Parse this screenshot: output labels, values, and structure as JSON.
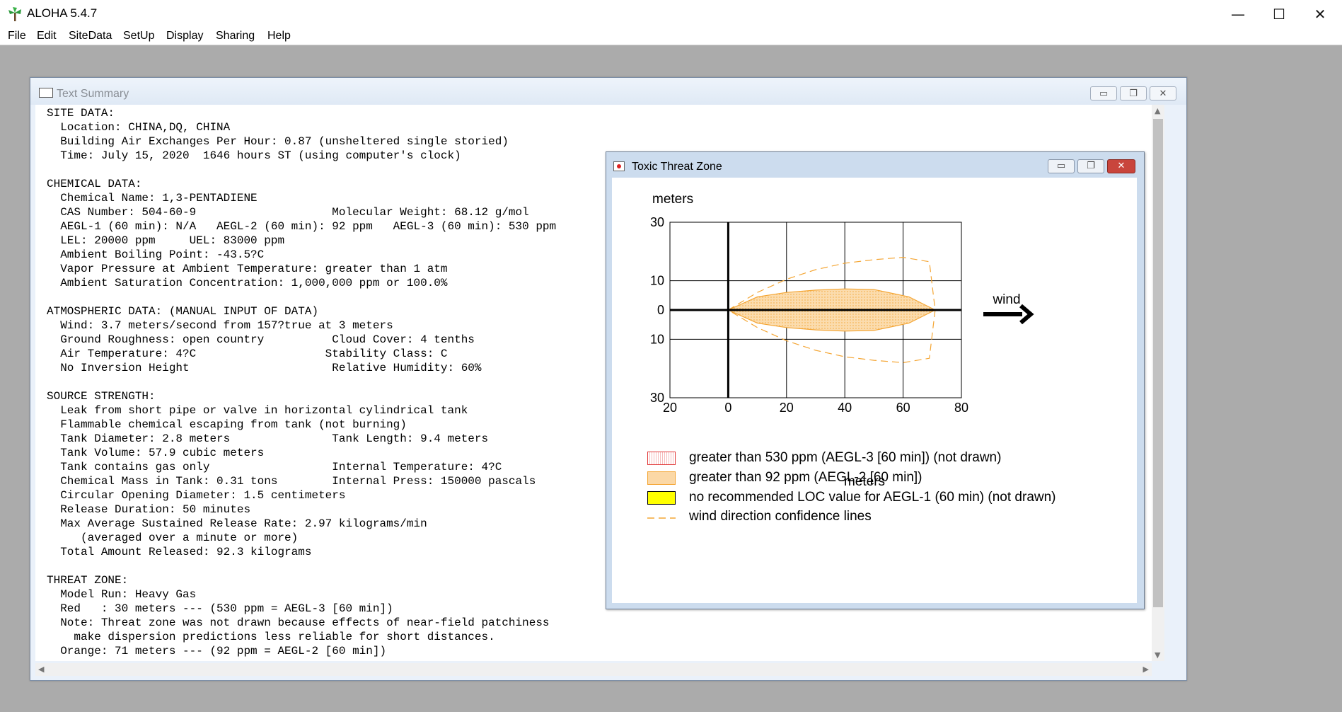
{
  "app": {
    "title": "ALOHA 5.4.7",
    "window_controls": {
      "minimize": "—",
      "maximize": "☐",
      "close": "✕"
    }
  },
  "menu": [
    "File",
    "Edit",
    "SiteData",
    "SetUp",
    "Display",
    "Sharing",
    "Help"
  ],
  "summary_window": {
    "title": "Text Summary",
    "text_lines": [
      "SITE DATA:",
      "  Location: CHINA,DQ, CHINA",
      "  Building Air Exchanges Per Hour: 0.87 (unsheltered single storied)",
      "  Time: July 15, 2020  1646 hours ST (using computer's clock)",
      "",
      "CHEMICAL DATA:",
      "  Chemical Name: 1,3-PENTADIENE",
      "  CAS Number: 504-60-9                    Molecular Weight: 68.12 g/mol",
      "  AEGL-1 (60 min): N/A   AEGL-2 (60 min): 92 ppm   AEGL-3 (60 min): 530 ppm",
      "  LEL: 20000 ppm     UEL: 83000 ppm",
      "  Ambient Boiling Point: -43.5?C",
      "  Vapor Pressure at Ambient Temperature: greater than 1 atm",
      "  Ambient Saturation Concentration: 1,000,000 ppm or 100.0%",
      "",
      "ATMOSPHERIC DATA: (MANUAL INPUT OF DATA)",
      "  Wind: 3.7 meters/second from 157?true at 3 meters",
      "  Ground Roughness: open country          Cloud Cover: 4 tenths",
      "  Air Temperature: 4?C                   Stability Class: C",
      "  No Inversion Height                     Relative Humidity: 60%",
      "",
      "SOURCE STRENGTH:",
      "  Leak from short pipe or valve in horizontal cylindrical tank",
      "  Flammable chemical escaping from tank (not burning)",
      "  Tank Diameter: 2.8 meters               Tank Length: 9.4 meters",
      "  Tank Volume: 57.9 cubic meters",
      "  Tank contains gas only                  Internal Temperature: 4?C",
      "  Chemical Mass in Tank: 0.31 tons        Internal Press: 150000 pascals",
      "  Circular Opening Diameter: 1.5 centimeters",
      "  Release Duration: 50 minutes",
      "  Max Average Sustained Release Rate: 2.97 kilograms/min",
      "     (averaged over a minute or more)",
      "  Total Amount Released: 92.3 kilograms",
      "",
      "THREAT ZONE:",
      "  Model Run: Heavy Gas",
      "  Red   : 30 meters --- (530 ppm = AEGL-3 [60 min])",
      "  Note: Threat zone was not drawn because effects of near-field patchiness",
      "    make dispersion predictions less reliable for short distances.",
      "  Orange: 71 meters --- (92 ppm = AEGL-2 [60 min])"
    ]
  },
  "threat_window": {
    "title": "Toxic Threat Zone",
    "chart_data": {
      "type": "area",
      "ylabel": "meters",
      "xlabel": "meters",
      "xlim": [
        -20,
        80
      ],
      "ylim": [
        -30,
        30
      ],
      "x_tick_labels": [
        {
          "value": -20,
          "label": "20"
        },
        {
          "value": 0,
          "label": "0"
        },
        {
          "value": 20,
          "label": "20"
        },
        {
          "value": 40,
          "label": "40"
        },
        {
          "value": 60,
          "label": "60"
        },
        {
          "value": 80,
          "label": "80"
        }
      ],
      "y_tick_labels": [
        {
          "value": 30,
          "label": "30"
        },
        {
          "value": 10,
          "label": "10"
        },
        {
          "value": 0,
          "label": "0"
        },
        {
          "value": -10,
          "label": "10"
        },
        {
          "value": -30,
          "label": "30"
        }
      ],
      "grid": true,
      "series": [
        {
          "name": "greater than 92 ppm (AEGL-2 [60 min])",
          "style": "filled",
          "color": "#f4a533",
          "fill": "#fbdcae",
          "points": [
            [
              0,
              0
            ],
            [
              10,
              4.5
            ],
            [
              20,
              6
            ],
            [
              30,
              6.8
            ],
            [
              40,
              7.2
            ],
            [
              50,
              7
            ],
            [
              62,
              4.5
            ],
            [
              71,
              0
            ],
            [
              62,
              -4.5
            ],
            [
              50,
              -7
            ],
            [
              40,
              -7.2
            ],
            [
              30,
              -6.8
            ],
            [
              20,
              -6
            ],
            [
              10,
              -4.5
            ],
            [
              0,
              0
            ]
          ]
        },
        {
          "name": "wind direction confidence lines",
          "style": "dashed",
          "color": "#f4a533",
          "points": [
            [
              0,
              0
            ],
            [
              10,
              6
            ],
            [
              20,
              10.5
            ],
            [
              30,
              13.8
            ],
            [
              40,
              16
            ],
            [
              50,
              17.2
            ],
            [
              60,
              18
            ],
            [
              69,
              16.5
            ],
            [
              71,
              0
            ],
            [
              69,
              -16.5
            ],
            [
              60,
              -18
            ],
            [
              50,
              -17.2
            ],
            [
              40,
              -16
            ],
            [
              30,
              -13.8
            ],
            [
              20,
              -10.5
            ],
            [
              10,
              -6
            ],
            [
              0,
              0
            ]
          ]
        }
      ],
      "wind_label": "wind"
    },
    "legend": [
      {
        "text": "greater than 530 ppm (AEGL-3 [60 min]) (not drawn)",
        "swatch": "red-dotted"
      },
      {
        "text": "greater than 92 ppm (AEGL-2 [60 min])",
        "swatch": "orange-fill"
      },
      {
        "text": "no recommended LOC value for AEGL-1 (60 min) (not drawn)",
        "swatch": "yellow-fill"
      },
      {
        "text": "wind direction confidence lines",
        "swatch": "orange-dash"
      }
    ],
    "colors": {
      "aegl3": "#e23b3b",
      "aegl2": "#f4a533",
      "aegl2_fill": "#fbdcae",
      "aegl1": "#ffff00"
    }
  }
}
